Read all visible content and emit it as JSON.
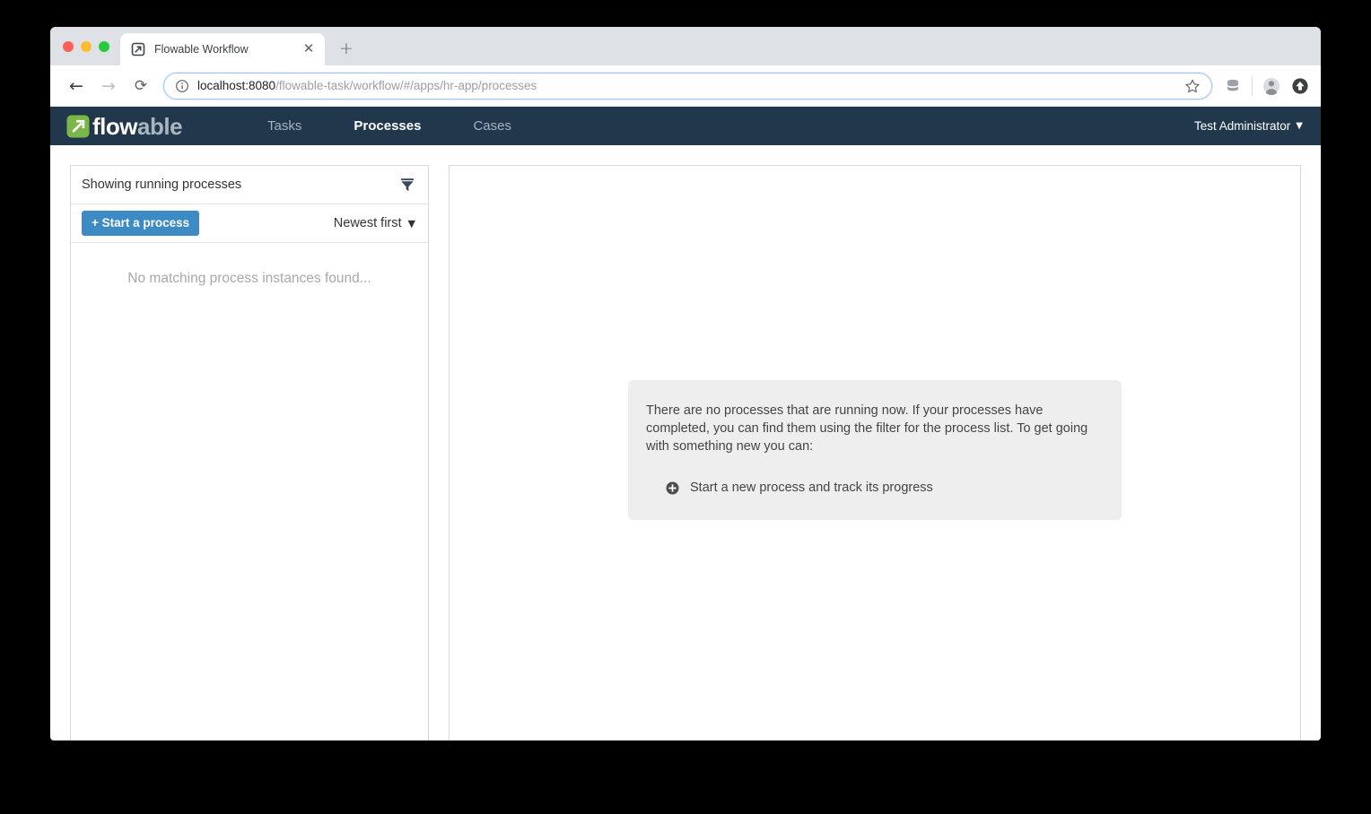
{
  "browser": {
    "tab": {
      "title": "Flowable Workflow",
      "favicon_icon": "flowable-favicon",
      "close_icon": "close-icon"
    },
    "new_tab_icon": "plus-icon",
    "back_icon": "arrow-left-icon",
    "forward_icon": "arrow-right-icon",
    "reload_icon": "reload-icon",
    "site_info_icon": "info-circle-icon",
    "url_host": "localhost:8080",
    "url_path": "/flowable-task/workflow/#/apps/hr-app/processes",
    "url_full": "localhost:8080/flowable-task/workflow/#/apps/hr-app/processes",
    "bookmark_icon": "star-icon",
    "extension_icon": "database-icon",
    "profile_icon": "account-avatar-icon",
    "update_icon": "update-arrow-icon",
    "window_controls": {
      "close": "close-traffic-light",
      "minimize": "minimize-traffic-light",
      "maximize": "maximize-traffic-light"
    }
  },
  "navbar": {
    "logo_mark_icon": "flowable-logo-mark",
    "logo_text_prefix": "flow",
    "logo_text_suffix": "able",
    "tabs": [
      {
        "label": "Tasks",
        "active": false
      },
      {
        "label": "Processes",
        "active": true
      },
      {
        "label": "Cases",
        "active": false
      }
    ],
    "user_name": "Test Administrator",
    "user_caret_icon": "chevron-down-icon",
    "background_color": "#21374b"
  },
  "sidebar": {
    "filter_label": "Showing running processes",
    "filter_icon": "filter-funnel-icon",
    "start_process_label": "+ Start a process",
    "start_process_color": "#3d8bc4",
    "sort_label": "Newest first",
    "sort_caret_icon": "chevron-down-icon",
    "empty_message": "No matching process instances found..."
  },
  "main": {
    "info_paragraph": "There are no processes that are running now. If your processes have completed, you can find them using the filter for the process list. To get going with something new you can:",
    "action_icon": "plus-circle-icon",
    "action_label": "Start a new process and track its progress",
    "info_box_color": "#eeeeee"
  }
}
